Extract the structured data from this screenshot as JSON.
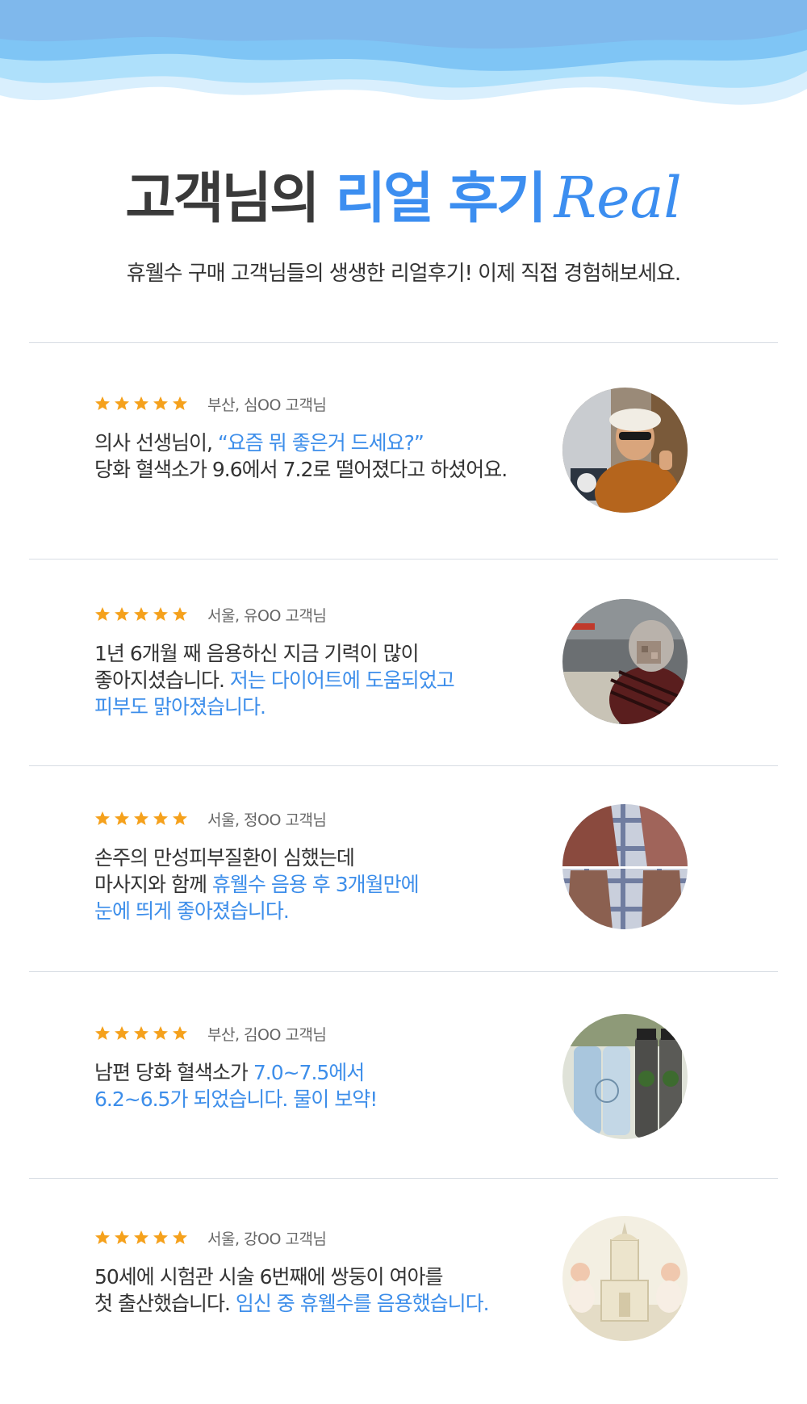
{
  "header": {
    "title_part1": "고객님의",
    "title_part2": "리얼 후기",
    "title_script": "Real",
    "subtitle": "휴웰수 구매 고객님들의 생생한 리얼후기! 이제 직접 경험해보세요."
  },
  "colors": {
    "accent": "#3c8ef0",
    "star": "#f5a11c",
    "wave_dark": "#7fb8ec",
    "wave_light": "#aee0fb"
  },
  "reviews": [
    {
      "rating": 5,
      "who": "부산, 심OO 고객님",
      "line1_plain": "의사 선생님이, ",
      "line1_hl": "“요즘 뭐 좋은거 드세요?”",
      "line2_plain": "당화 혈색소가 9.6에서 7.2로 떨어졌다고 하셨어요.",
      "line2_hl": "",
      "line3_hl": "",
      "photo_icon": "customer-photo-man-thumbs-up"
    },
    {
      "rating": 5,
      "who": "서울, 유OO 고객님",
      "line1_plain": "1년 6개월 째 음용하신 지금 기력이 많이",
      "line1_hl": "",
      "line2_plain": "좋아지셨습니다. ",
      "line2_hl": "저는 다이어트에 도움되었고",
      "line3_hl": "피부도 맑아졌습니다.",
      "photo_icon": "customer-photo-grandmother-kitchen"
    },
    {
      "rating": 5,
      "who": "서울, 정OO 고객님",
      "line1_plain": "손주의 만성피부질환이 심했는데",
      "line1_hl": "",
      "line2_plain": "마사지와 함께 ",
      "line2_hl": "휴웰수 음용 후 3개월만에",
      "line3_hl": "눈에 띄게 좋아졌습니다.",
      "photo_icon": "customer-photo-skin-before-after"
    },
    {
      "rating": 5,
      "who": "부산, 김OO 고객님",
      "line1_plain": "남편 당화 혈색소가 ",
      "line1_hl": "7.0~7.5에서",
      "line2_plain": "",
      "line2_hl": "6.2~6.5가 되었습니다. 물이 보약!",
      "line3_hl": "",
      "photo_icon": "customer-photo-water-bottles"
    },
    {
      "rating": 5,
      "who": "서울, 강OO 고객님",
      "line1_plain": "50세에 시험관 시술 6번째에 쌍둥이 여아를",
      "line1_hl": "",
      "line2_plain": "첫 출산했습니다. ",
      "line2_hl": "임신 중 휴웰수를 음용했습니다.",
      "line3_hl": "",
      "photo_icon": "customer-photo-twin-babies"
    }
  ]
}
